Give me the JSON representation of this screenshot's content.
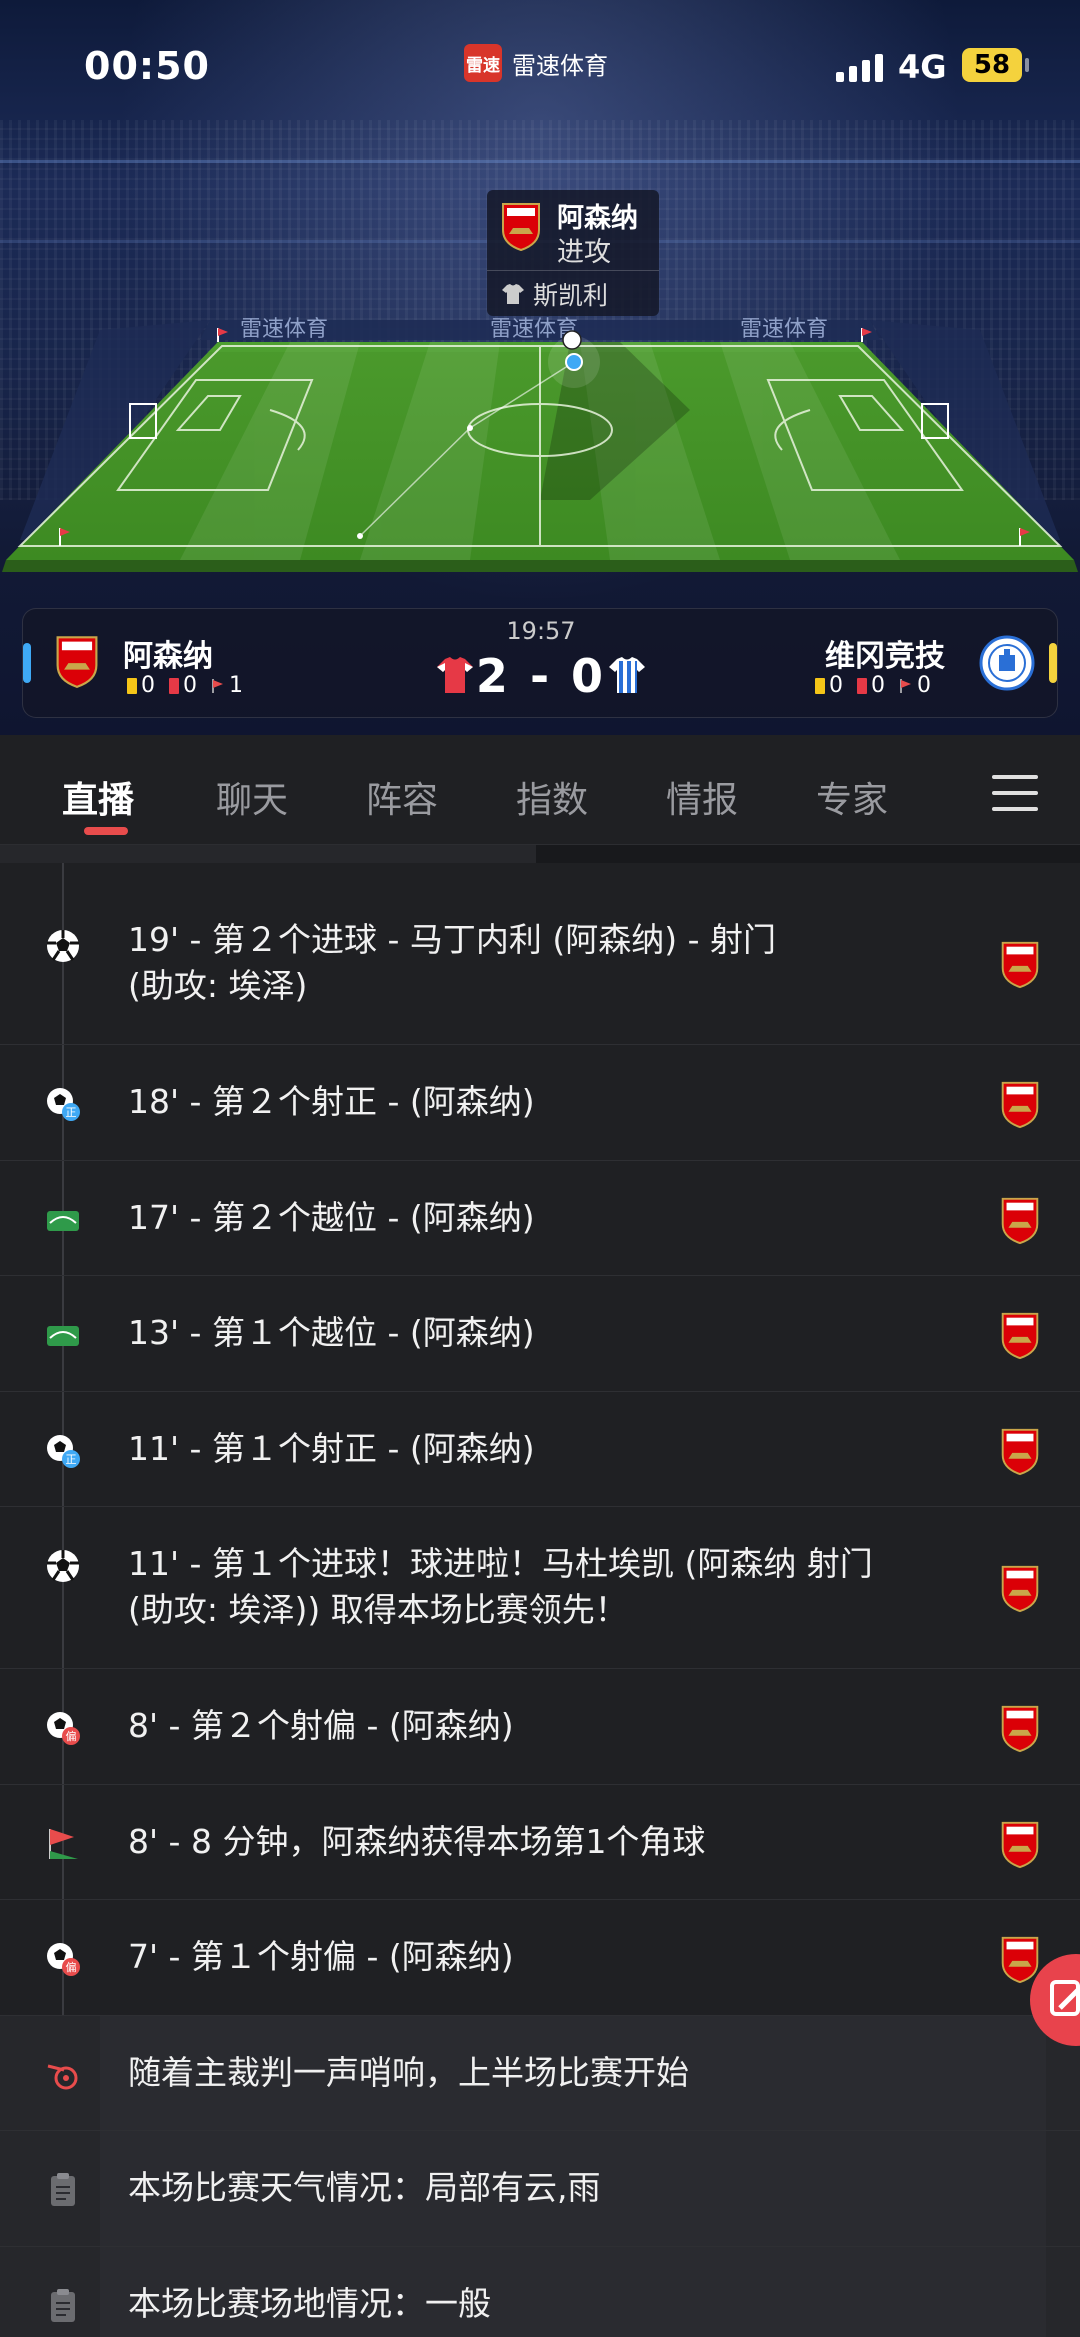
{
  "status": {
    "time": "00:50",
    "network": "4G",
    "battery": "58"
  },
  "app": {
    "name": "雷速体育",
    "logo_text": "雷速"
  },
  "brand": {
    "board_text": "雷速体育"
  },
  "attack": {
    "team": "阿森纳",
    "action": "进攻",
    "player": "斯凯利"
  },
  "match": {
    "clock": "19:57",
    "score": "2 - 0",
    "home": {
      "name": "阿森纳",
      "yellow": "0",
      "red": "0",
      "corners": "1",
      "color": "#e63946"
    },
    "away": {
      "name": "维冈竞技",
      "yellow": "0",
      "red": "0",
      "corners": "0",
      "color": "#3fa9f5"
    }
  },
  "tabs": [
    "直播",
    "聊天",
    "阵容",
    "指数",
    "情报",
    "专家"
  ],
  "events": [
    {
      "icon": "goal-icon",
      "text": [
        "19' - 第２个进球 - 马丁内利 (阿森纳) - 射门",
        "(助攻: 埃泽)"
      ]
    },
    {
      "icon": "shot-on-target-icon",
      "badge": "正",
      "text": [
        "18' - 第２个射正 - (阿森纳)"
      ]
    },
    {
      "icon": "offside-icon",
      "text": [
        "17' - 第２个越位 - (阿森纳)"
      ]
    },
    {
      "icon": "offside-icon",
      "text": [
        "13' - 第１个越位 - (阿森纳)"
      ]
    },
    {
      "icon": "shot-on-target-icon",
      "badge": "正",
      "text": [
        "11' - 第１个射正 - (阿森纳)"
      ]
    },
    {
      "icon": "goal-icon",
      "text": [
        "11' - 第１个进球！球进啦！马杜埃凯 (阿森纳 射门",
        "(助攻: 埃泽)) 取得本场比赛领先！"
      ]
    },
    {
      "icon": "shot-off-target-icon",
      "badge": "偏",
      "text": [
        "8' - 第２个射偏 - (阿森纳)"
      ]
    },
    {
      "icon": "corner-flag-icon",
      "text": [
        "8' - 8 分钟，阿森纳获得本场第1个角球"
      ]
    },
    {
      "icon": "shot-off-target-icon",
      "badge": "偏",
      "text": [
        "7' - 第１个射偏 - (阿森纳)"
      ]
    },
    {
      "icon": "whistle-icon",
      "text": [
        "随着主裁判一声哨响，上半场比赛开始"
      ]
    },
    {
      "icon": "clipboard-icon",
      "text": [
        "本场比赛天气情况：局部有云,雨"
      ]
    },
    {
      "icon": "clipboard-icon",
      "text": [
        "本场比赛场地情况：一般"
      ]
    }
  ]
}
